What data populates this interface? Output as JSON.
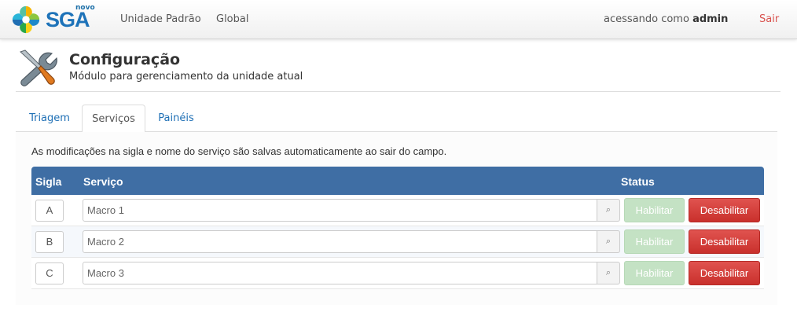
{
  "brand": {
    "small": "novo",
    "name": "SGA"
  },
  "nav": {
    "links": [
      "Unidade Padrão",
      "Global"
    ],
    "user_prefix": "acessando como",
    "user_name": "admin",
    "logout": "Sair"
  },
  "header": {
    "title": "Configuração",
    "subtitle": "Módulo para gerenciamento da unidade atual"
  },
  "tabs": [
    {
      "label": "Triagem",
      "active": false
    },
    {
      "label": "Serviços",
      "active": true
    },
    {
      "label": "Painéis",
      "active": false
    }
  ],
  "info": "As modificações na sigla e nome do serviço são salvas automaticamente ao sair do campo.",
  "table": {
    "columns": [
      "Sigla",
      "Serviço",
      "Status"
    ],
    "rows": [
      {
        "sigla": "A",
        "servico": "Macro 1"
      },
      {
        "sigla": "B",
        "servico": "Macro 2"
      },
      {
        "sigla": "C",
        "servico": "Macro 3"
      }
    ],
    "enable_label": "Habilitar",
    "disable_label": "Desabilitar"
  },
  "colors": {
    "header_blue": "#3f6ea4",
    "danger": "#d9534f",
    "success_disabled": "#c4e2c4",
    "link": "#1e6fb5"
  }
}
